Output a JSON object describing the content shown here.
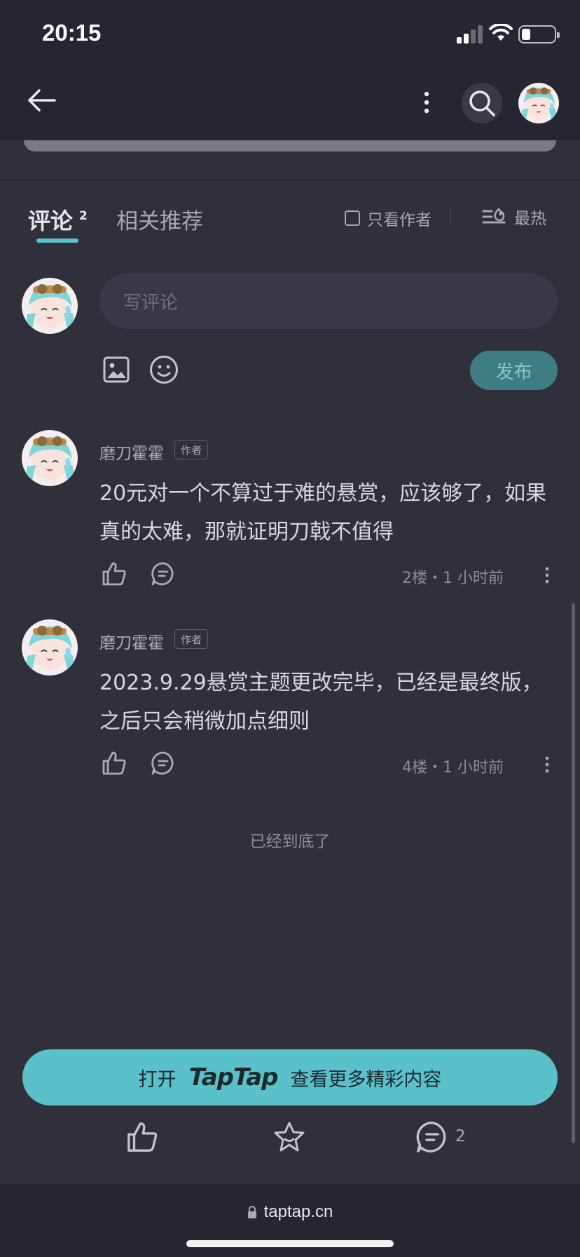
{
  "status_bar": {
    "time": "20:15"
  },
  "tabs": {
    "comments_label": "评论",
    "comments_count": "2",
    "related_label": "相关推荐"
  },
  "filters": {
    "author_only_label": "只看作者",
    "sort_label": "最热"
  },
  "composer": {
    "placeholder": "写评论",
    "publish_label": "发布"
  },
  "comments": [
    {
      "author": "磨刀霍霍",
      "badge": "作者",
      "text": "20元对一个不算过于难的悬赏，应该够了，如果真的太难，那就证明刀戟不值得",
      "meta": "2楼・1 小时前"
    },
    {
      "author": "磨刀霍霍",
      "badge": "作者",
      "text": "2023.9.29悬赏主题更改完毕，已经是最终版，之后只会稍微加点细则",
      "meta": "4楼・1 小时前"
    }
  ],
  "end_text": "已经到底了",
  "open_app": {
    "prefix": "打开",
    "logo": "TapTap",
    "suffix": "查看更多精彩内容"
  },
  "bottom_actions": {
    "comment_count": "2"
  },
  "browser": {
    "url": "taptap.cn"
  },
  "colors": {
    "accent": "#5ac1cb",
    "background": "#2f3039",
    "bar": "#252630"
  }
}
